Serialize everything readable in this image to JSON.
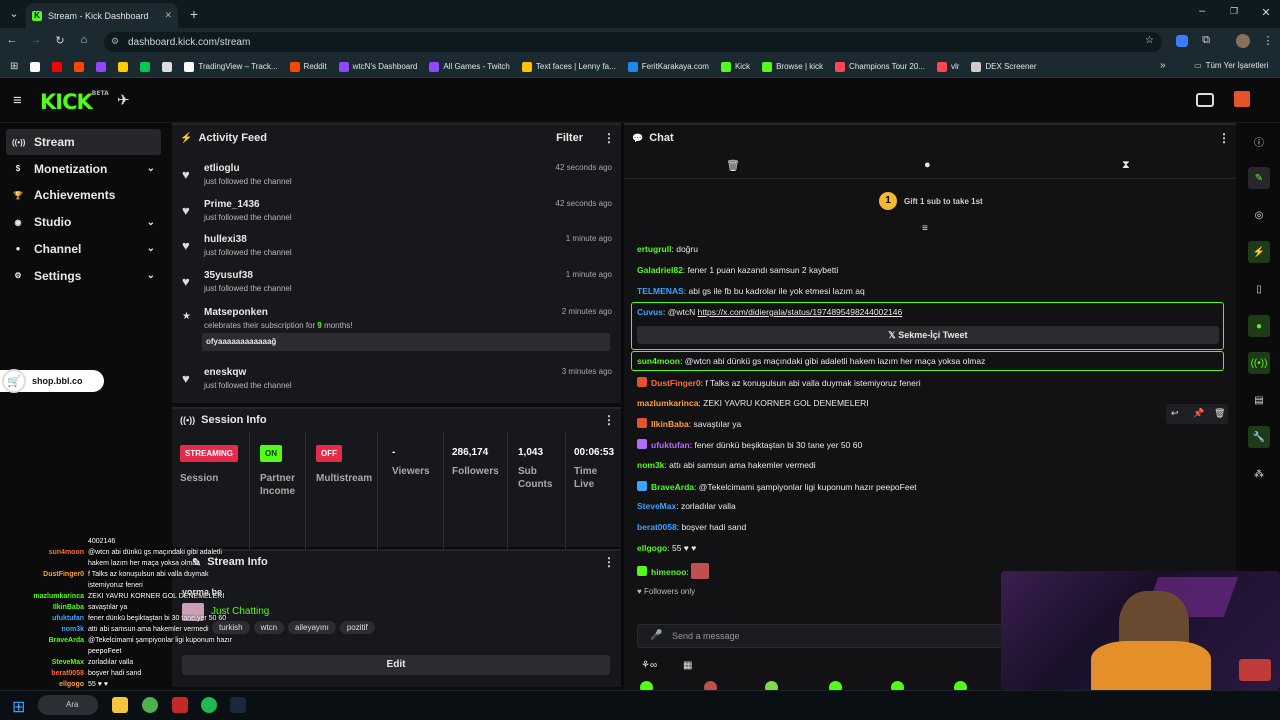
{
  "browser": {
    "tab_title": "Stream - Kick Dashboard",
    "url": "dashboard.kick.com/stream",
    "bookmarks": [
      {
        "label": "",
        "color": "#ffffff"
      },
      {
        "label": "",
        "color": "#ff0000"
      },
      {
        "label": "",
        "color": "#ff4500"
      },
      {
        "label": "",
        "color": "#9146ff"
      },
      {
        "label": "",
        "color": "#ffcc00"
      },
      {
        "label": "",
        "color": "#00c853"
      },
      {
        "label": "",
        "color": "#dddddd"
      },
      {
        "label": "TradingView – Track...",
        "color": "#ffffff"
      },
      {
        "label": "Reddit",
        "color": "#ff4500"
      },
      {
        "label": "wtcN's Dashboard",
        "color": "#9146ff"
      },
      {
        "label": "All Games - Twitch",
        "color": "#9146ff"
      },
      {
        "label": "Text faces | Lenny fa...",
        "color": "#ffc107"
      },
      {
        "label": "FeritKarakaya.com",
        "color": "#1e88e5"
      },
      {
        "label": "Kick",
        "color": "#53fc18"
      },
      {
        "label": "Browse | kick",
        "color": "#53fc18"
      },
      {
        "label": "Champions Tour 20...",
        "color": "#ff4655"
      },
      {
        "label": "vlr",
        "color": "#ff4655"
      },
      {
        "label": "DEX Screener",
        "color": "#cccccc"
      }
    ],
    "all_bookmarks_label": "Tüm Yer İşaretleri"
  },
  "app": {
    "logo": "KICK",
    "logo_tag": "BETA"
  },
  "sidebar": {
    "items": [
      {
        "label": "Stream",
        "icon": "broadcast-icon",
        "active": true,
        "chevron": false
      },
      {
        "label": "Monetization",
        "icon": "dollar-icon",
        "active": false,
        "chevron": true
      },
      {
        "label": "Achievements",
        "icon": "trophy-icon",
        "active": false,
        "chevron": false
      },
      {
        "label": "Studio",
        "icon": "studio-icon",
        "active": false,
        "chevron": true
      },
      {
        "label": "Channel",
        "icon": "person-icon",
        "active": false,
        "chevron": true
      },
      {
        "label": "Settings",
        "icon": "gear-icon",
        "active": false,
        "chevron": true
      }
    ],
    "shop_label": "shop.bbl.co"
  },
  "activity": {
    "title": "Activity Feed",
    "filter_label": "Filter",
    "items": [
      {
        "user": "etlioglu",
        "action": "just followed the channel",
        "time": "42 seconds ago"
      },
      {
        "user": "Prime_1436",
        "action": "just followed the channel",
        "time": "42 seconds ago"
      },
      {
        "user": "hullexi38",
        "action": "just followed the channel",
        "time": "1 minute ago"
      },
      {
        "user": "35yusuf38",
        "action": "just followed the channel",
        "time": "1 minute ago"
      }
    ],
    "sub": {
      "user": "Matseponken",
      "action_pre": "celebrates their subscription for ",
      "months": "9",
      "action_post": " months!",
      "time": "2 minutes ago",
      "message": "ofyaaaaaaaaaaaağ"
    },
    "last": {
      "user": "eneskqw",
      "action": "just followed the channel",
      "time": "3 minutes ago"
    }
  },
  "session": {
    "title": "Session Info",
    "streaming_badge": "STREAMING",
    "session_label": "Session",
    "on_badge": "ON",
    "partner_label": "Partner Income",
    "off_badge": "OFF",
    "multistream_label": "Multistream",
    "viewers_value": "-",
    "viewers_label": "Viewers",
    "followers_value": "286,174",
    "followers_label": "Followers",
    "subs_value": "1,043",
    "subs_label": "Sub Counts",
    "time_value": "00:06:53",
    "time_label": "Time Live"
  },
  "stream_info": {
    "title": "Stream Info",
    "stream_title": "yorma be",
    "category": "Just Chatting",
    "tags": [
      "turkish",
      "wtcn",
      "aileyayını",
      "pozitif"
    ],
    "edit_label": "Edit"
  },
  "chat": {
    "title": "Chat",
    "gift_number": "1",
    "gift_text": "Gift 1 sub to take 1st",
    "messages": [
      {
        "user": "ertugrull",
        "color": "#53fc18",
        "text": "doğru"
      },
      {
        "user": "Galadriel82",
        "color": "#53fc18",
        "text": "fener 1 puan kazandı samsun 2 kaybetti"
      },
      {
        "user": "TELMENAS",
        "color": "#3ba3ff",
        "text": "abi gs ile fb bu kadrolar ile yok etmesi lazım aq"
      },
      {
        "user": "Cuvus",
        "color": "#3ba3ff",
        "text": "@wtcN ",
        "link": "https://x.com/didiergala/status/1974895498244002146",
        "tweet_label": "Sekme-İçi Tweet"
      },
      {
        "user": "sun4moon",
        "color": "#53fc18",
        "text": "@wtcn abi dünkü gs maçındaki gibi adaletli hakem lazım her maça yoksa olmaz"
      },
      {
        "user": "DustFinger0",
        "color": "#ff6a3d",
        "text": "f Talks az konuşulsun abi valla duymak istemiyoruz feneri"
      },
      {
        "user": "mazlumkarinca",
        "color": "#ff9e3d",
        "text": "ZEKI YAVRU KORNER GOL DENEMELERI"
      },
      {
        "user": "IlkinBaba",
        "color": "#ff9e3d",
        "text": "savaştılar ya"
      },
      {
        "user": "ufuktufan",
        "color": "#b36bff",
        "text": "fener dünkü beşiktaştan bi 30 tane yer 50 60"
      },
      {
        "user": "nom3k",
        "color": "#53fc18",
        "text": "attı abi samsun ama hakemler vermedi"
      },
      {
        "user": "BraveArda",
        "color": "#53fc18",
        "text": "@Tekelcimami şampiyonlar ligi kuponum hazır peepoFeet"
      },
      {
        "user": "SteveMax",
        "color": "#3ba3ff",
        "text": "zorladılar valla"
      },
      {
        "user": "berat0058",
        "color": "#3ba3ff",
        "text": "boşver hadi sand"
      },
      {
        "user": "ellgogo",
        "color": "#53fc18",
        "text": "55 ♥ ♥"
      },
      {
        "user": "himenoo",
        "color": "#53fc18",
        "text": ""
      }
    ],
    "followers_only": "Followers only",
    "send_placeholder": "Send a message"
  },
  "overlay": {
    "lines": [
      {
        "name": "",
        "text": "4002146"
      },
      {
        "name": "sun4moon",
        "text": "@wtcn abi dünkü gs maçındaki gibi adaletli"
      },
      {
        "name": "",
        "text": "hakem lazım her maça yoksa olmaz"
      },
      {
        "name": "DustFinger0",
        "text": "f Talks az konuşulsun abi valla duymak"
      },
      {
        "name": "",
        "text": "istemiyoruz feneri"
      },
      {
        "name": "mazlumkarinca",
        "text": "ZEKI YAVRU KORNER GOL DENEMELERI"
      },
      {
        "name": "IlkinBaba",
        "text": "savaştılar ya"
      },
      {
        "name": "ufuktufan",
        "text": "fener dünkü beşiktaştan bi 30 tane yer 50 60"
      },
      {
        "name": "nom3k",
        "text": "attı abi samsun ama hakemler vermedi"
      },
      {
        "name": "BraveArda",
        "text": "@Tekelcimami şampiyonlar ligi kuponum hazır"
      },
      {
        "name": "",
        "text": "peepoFeet"
      },
      {
        "name": "SteveMax",
        "text": "zorladılar valla"
      },
      {
        "name": "berat0058",
        "text": "boşver hadi sand"
      },
      {
        "name": "ellgogo",
        "text": "55 ♥ ♥"
      },
      {
        "name": "himenoo",
        "text": ""
      }
    ]
  },
  "taskbar": {
    "search_label": "Ara"
  }
}
